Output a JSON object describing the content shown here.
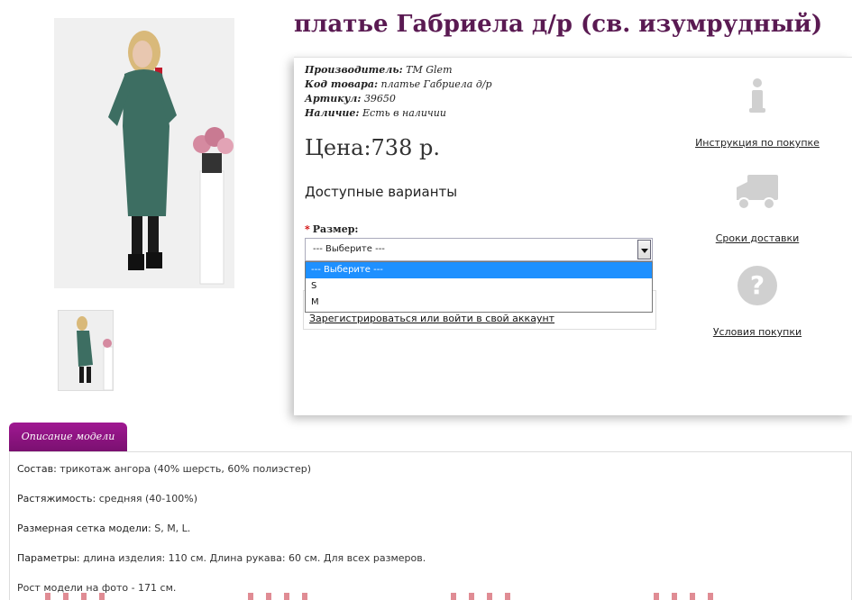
{
  "product": {
    "title": "платье Габриела д/р (св. изумрудный)",
    "meta": [
      {
        "label": "Производитель:",
        "value": "ТМ Glem"
      },
      {
        "label": "Код товара:",
        "value": "платье Габриела д/р"
      },
      {
        "label": "Артикул:",
        "value": "39650"
      },
      {
        "label": "Наличие:",
        "value": "Есть в наличии"
      }
    ],
    "price": "Цена:738 р.",
    "variants_title": "Доступные варианты",
    "size_label": "Размер:",
    "size_required_mark": "*",
    "select_value": "--- Выберите ---",
    "size_options": [
      "--- Выберите ---",
      "S",
      "M"
    ],
    "login_link": "Зарегистрироваться или войти в свой аккаунт"
  },
  "sidebar": {
    "items": [
      {
        "label": "Инструкция по покупке",
        "icon": "info-icon"
      },
      {
        "label": "Сроки доставки",
        "icon": "truck-icon"
      },
      {
        "label": "Условия покупки",
        "icon": "question-icon"
      }
    ]
  },
  "tab": {
    "label": "Описание модели"
  },
  "description": {
    "rows": [
      {
        "label": "Состав:",
        "value": "трикотаж ангора (40% шерсть, 60% полиэстер)"
      },
      {
        "label": "Растяжимость:",
        "value": "средняя (40-100%)"
      },
      {
        "label": "Размерная сетка модели:",
        "value": "S, M, L."
      },
      {
        "label": "Параметры:",
        "value": "длина изделия: 110 см. Длина рукава: 60 см. Для всех размеров."
      },
      {
        "label": "",
        "value": "Рост модели на фото - 171 см."
      }
    ]
  },
  "colors": {
    "title": "#5a1a52",
    "tab": "#8a1480",
    "dress": "#3d6e62",
    "select_highlight": "#1e90ff",
    "icon_gray": "#d0d0d0"
  }
}
